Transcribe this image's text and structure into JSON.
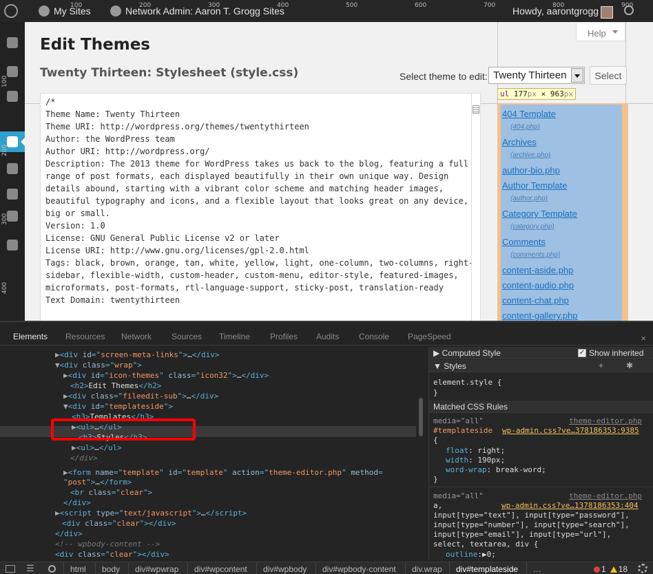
{
  "adminbar": {
    "my_sites": "My Sites",
    "network_admin": "Network Admin: Aaron T. Grogg Sites",
    "howdy": "Howdy, aarontgrogg"
  },
  "rulers": {
    "top": [
      "100",
      "200",
      "300",
      "400",
      "500",
      "600",
      "700",
      "800",
      "900"
    ],
    "left": [
      "100",
      "200",
      "300",
      "400"
    ]
  },
  "page": {
    "title": "Edit Themes",
    "file_title": "Twenty Thirteen: Stylesheet (style.css)",
    "help_label": "Help",
    "select_label": "Select theme to edit:",
    "selected_theme": "Twenty Thirteen",
    "select_button": "Select"
  },
  "editor": {
    "content": "/*\nTheme Name: Twenty Thirteen\nTheme URI: http://wordpress.org/themes/twentythirteen\nAuthor: the WordPress team\nAuthor URI: http://wordpress.org/\nDescription: The 2013 theme for WordPress takes us back to the blog, featuring a full\nrange of post formats, each displayed beautifully in their own unique way. Design\ndetails abound, starting with a vibrant color scheme and matching header images,\nbeautiful typography and icons, and a flexible layout that looks great on any device,\nbig or small.\nVersion: 1.0\nLicense: GNU General Public License v2 or later\nLicense URI: http://www.gnu.org/licenses/gpl-2.0.html\nTags: black, brown, orange, tan, white, yellow, light, one-column, two-columns, right-\nsidebar, flexible-width, custom-header, custom-menu, editor-style, featured-images,\nmicroformats, post-formats, rtl-language-support, sticky-post, translation-ready\nText Domain: twentythirteen"
  },
  "tooltip": {
    "tag": "ul",
    "width": "177",
    "height": "963",
    "unit": "px",
    "times": "×"
  },
  "templates": [
    {
      "name": "404 Template",
      "file": "(404.php)"
    },
    {
      "name": "Archives",
      "file": "(archive.php)"
    },
    {
      "name": "author-bio.php",
      "file": ""
    },
    {
      "name": "Author Template",
      "file": "(author.php)"
    },
    {
      "name": "Category Template",
      "file": "(category.php)"
    },
    {
      "name": "Comments",
      "file": "(comments.php)"
    },
    {
      "name": "content-aside.php",
      "file": ""
    },
    {
      "name": "content-audio.php",
      "file": ""
    },
    {
      "name": "content-chat.php",
      "file": ""
    },
    {
      "name": "content-gallery.php",
      "file": ""
    }
  ],
  "devtools": {
    "tabs": [
      "Elements",
      "Resources",
      "Network",
      "Sources",
      "Timeline",
      "Profiles",
      "Audits",
      "Console",
      "PageSpeed"
    ],
    "active_tab": "Elements",
    "close": "×",
    "sidebar": {
      "computed_style": "Computed Style",
      "show_inherited": "Show inherited",
      "styles": "Styles",
      "element_style": "element.style {",
      "close_brace": "}",
      "matched_rules": "Matched CSS Rules",
      "rule1_media": "media=\"all\"",
      "rule1_file": "theme-editor.php",
      "rule1_selector": "#templateside",
      "rule1_source": "wp-admin.css?ve…378186353:9385",
      "rule1_open": "{",
      "rule1_props": [
        "float",
        "width",
        "word-wrap"
      ],
      "rule1_vals": [
        ": right;",
        ": 190px;",
        ": break-word;"
      ],
      "rule2_media": "media=\"all\"",
      "rule2_file": "theme-editor.php",
      "rule2_source": "wp-admin.css?ve…1378186353:404",
      "rule2_selector_lines": [
        "a,",
        "input[type=\"text\"], input[type=\"password\"],",
        "input[type=\"number\"], input[type=\"search\"],",
        "input[type=\"email\"], input[type=\"url\"],",
        "select, textarea, div {"
      ],
      "rule2_prop": "outline",
      "rule2_val": ":▶0;"
    },
    "crumbs": [
      "html",
      "body",
      "div#wpwrap",
      "div#wpcontent",
      "div#wpbody",
      "div#wpbody-content",
      "div.wrap",
      "div#templateside",
      "…"
    ],
    "active_crumb": "div#templateside",
    "errors": "1",
    "warnings": "18"
  }
}
